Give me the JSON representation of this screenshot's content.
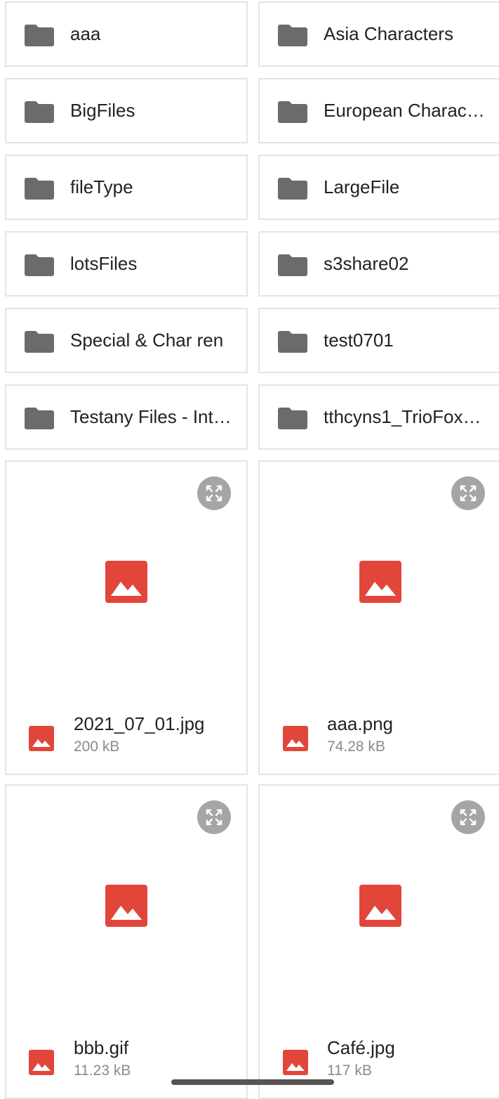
{
  "folders": [
    {
      "name": "aaa",
      "icon": "folder-icon"
    },
    {
      "name": "Asia Characters",
      "icon": "folder-icon"
    },
    {
      "name": "BigFiles",
      "icon": "folder-icon"
    },
    {
      "name": "European Charac…",
      "icon": "folder-icon"
    },
    {
      "name": "fileType",
      "icon": "folder-icon"
    },
    {
      "name": "LargeFile",
      "icon": "folder-icon"
    },
    {
      "name": "lotsFiles",
      "icon": "folder-icon"
    },
    {
      "name": "s3share02",
      "icon": "folder-icon"
    },
    {
      "name": "Special & Char ren",
      "icon": "folder-icon"
    },
    {
      "name": "test0701",
      "icon": "folder-icon"
    },
    {
      "name": "Testany Files - Int…",
      "icon": "folder-icon"
    },
    {
      "name": "tthcyns1_TrioFox…",
      "icon": "folder-icon"
    }
  ],
  "files": [
    {
      "name": "2021_07_01.jpg",
      "size": "200 kB",
      "icon": "image-icon"
    },
    {
      "name": "aaa.png",
      "size": "74.28 kB",
      "icon": "image-icon"
    },
    {
      "name": "bbb.gif",
      "size": "11.23 kB",
      "icon": "image-icon"
    },
    {
      "name": "Café.jpg",
      "size": "117 kB",
      "icon": "image-icon"
    }
  ],
  "colors": {
    "folder": "#6b6b6b",
    "image_accent": "#e2463b",
    "card_border": "#e4e4e4",
    "expand_button": "#a5a5a5"
  }
}
